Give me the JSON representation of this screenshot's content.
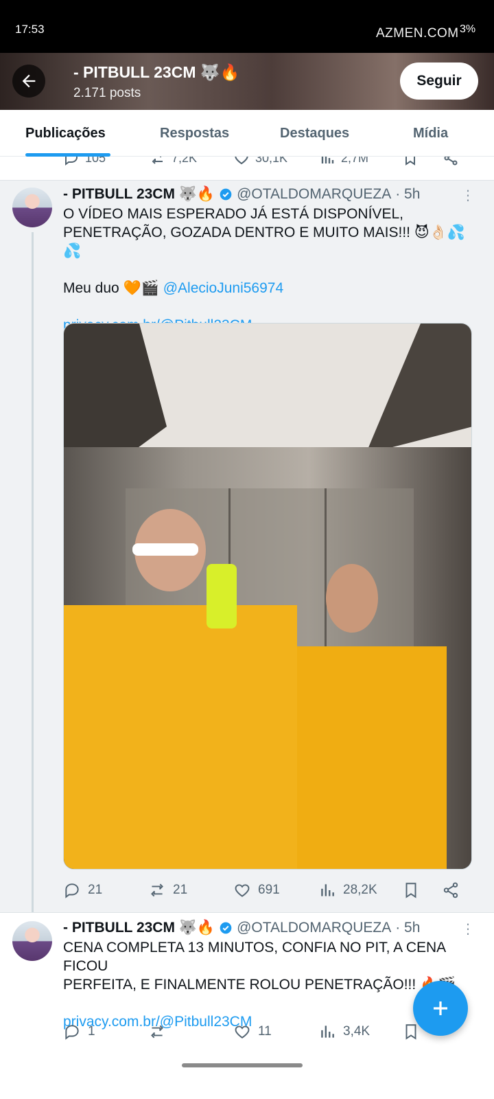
{
  "status_bar": {
    "time": "17:53",
    "watermark": "AZMEN.COM",
    "battery": "3%"
  },
  "header": {
    "title": "- PITBULL 23CM 🐺🔥",
    "posts_count": "2.171 posts",
    "follow_label": "Seguir"
  },
  "tabs": [
    {
      "label": "Publicações",
      "active": true
    },
    {
      "label": "Respostas",
      "active": false
    },
    {
      "label": "Destaques",
      "active": false
    },
    {
      "label": "Mídia",
      "active": false
    }
  ],
  "previous_tweet_stats": {
    "replies": "105",
    "retweets": "7,2K",
    "likes": "30,1K",
    "views": "2,7M"
  },
  "tweets": [
    {
      "author_name": "- PITBULL 23CM 🐺🔥",
      "handle": "@OTALDOMARQUEZA",
      "time": "· 5h",
      "text_line1": "O VÍDEO MAIS ESPERADO JÁ ESTÁ DISPONÍVEL,",
      "text_line2": "PENETRAÇÃO, GOZADA DENTRO E MUITO MAIS!!! 😈👌🏻💦💦",
      "duo_label": "Meu duo 🧡🎬",
      "mention": "@AlecioJuni56974",
      "link": "privacy.com.br/@Pitbull23CM",
      "replies": "21",
      "retweets": "21",
      "likes": "691",
      "views": "28,2K"
    },
    {
      "author_name": "- PITBULL 23CM 🐺🔥",
      "handle": "@OTALDOMARQUEZA",
      "time": "· 5h",
      "text_line1": "CENA COMPLETA 13 MINUTOS, CONFIA NO PIT, A CENA FICOU",
      "text_line2": "PERFEITA, E FINALMENTE ROLOU PENETRAÇÃO!!! 🔥🎬",
      "link": "privacy.com.br/@Pitbull23CM",
      "replies": "1",
      "retweets": "",
      "likes": "11",
      "views": "3,4K"
    }
  ],
  "colors": {
    "accent": "#1d9bf0",
    "text_primary": "#0f1419",
    "text_secondary": "#536471"
  }
}
